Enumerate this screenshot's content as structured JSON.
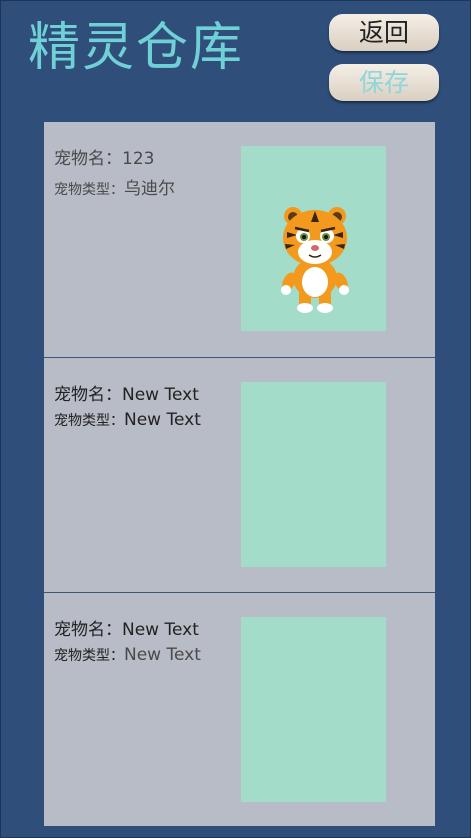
{
  "header": {
    "title": "精灵仓库",
    "back_label": "返回",
    "save_label": "保存"
  },
  "labels": {
    "pet_name": "宠物名：",
    "pet_type": "宠物类型："
  },
  "cards": [
    {
      "name": "123",
      "type": "乌迪尔",
      "pet_icon": "tiger-icon"
    },
    {
      "name": "New Text",
      "type": "New Text"
    },
    {
      "name": "New Text",
      "type": "New Text"
    }
  ],
  "colors": {
    "background": "#2f4e7a",
    "title": "#6fd0d6",
    "panel": "#b8bcc6",
    "pet_slot": "#a3dcc9",
    "save_text": "#8fd5d9"
  }
}
